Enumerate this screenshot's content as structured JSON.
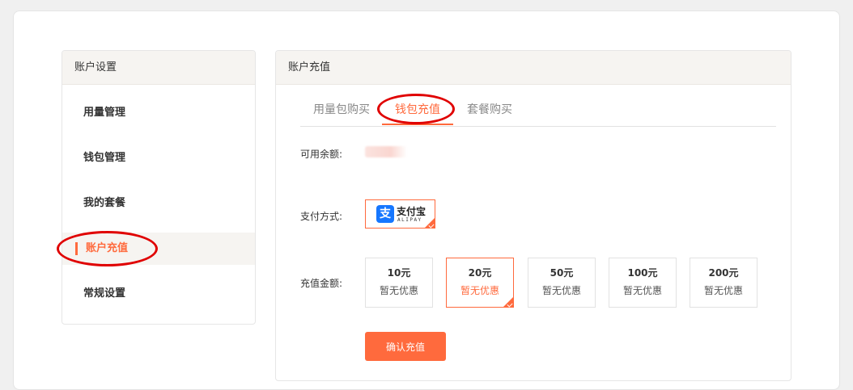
{
  "sidebar": {
    "title": "账户设置",
    "items": [
      {
        "label": "用量管理"
      },
      {
        "label": "钱包管理"
      },
      {
        "label": "我的套餐"
      },
      {
        "label": "账户充值"
      },
      {
        "label": "常规设置"
      }
    ],
    "active_index": 3
  },
  "main": {
    "title": "账户充值",
    "tabs": [
      {
        "label": "用量包购买"
      },
      {
        "label": "钱包充值"
      },
      {
        "label": "套餐购买"
      }
    ],
    "active_tab": 1,
    "balance_label": "可用余额:",
    "payment_label": "支付方式:",
    "payment_method": {
      "name": "支付宝",
      "sub": "ALIPAY",
      "logo_glyph": "支",
      "icon": "alipay-icon"
    },
    "amount_label": "充值金额:",
    "amounts": [
      {
        "value": "10元",
        "note": "暂无优惠"
      },
      {
        "value": "20元",
        "note": "暂无优惠"
      },
      {
        "value": "50元",
        "note": "暂无优惠"
      },
      {
        "value": "100元",
        "note": "暂无优惠"
      },
      {
        "value": "200元",
        "note": "暂无优惠"
      }
    ],
    "selected_amount": 1,
    "confirm_label": "确认充值"
  },
  "colors": {
    "accent": "#ff6a3d",
    "annotation": "#e00000",
    "alipay": "#1677ff"
  }
}
